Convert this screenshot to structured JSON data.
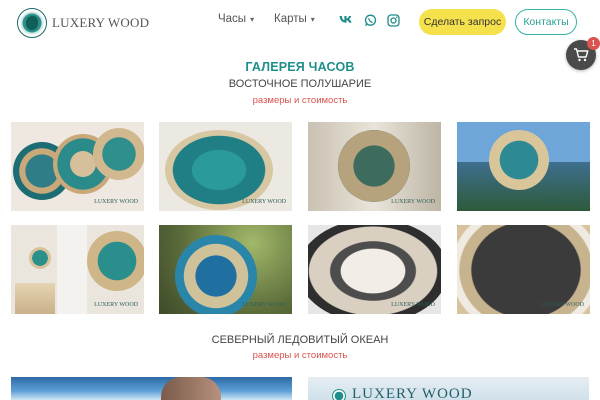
{
  "header": {
    "logo_text": "LUXERY WOOD",
    "nav": [
      {
        "label": "Часы"
      },
      {
        "label": "Карты"
      }
    ],
    "social": [
      {
        "name": "vk-icon",
        "glyph": "vk"
      },
      {
        "name": "whatsapp-icon",
        "glyph": "✆"
      },
      {
        "name": "instagram-icon",
        "glyph": "◎"
      }
    ],
    "request_button": "Сделать запрос",
    "contacts_button": "Контакты",
    "cart_count": "1"
  },
  "gallery": {
    "title": "ГАЛЕРЕЯ ЧАСОВ",
    "subtitle": "ВОСТОЧНОЕ ПОЛУШАРИЕ",
    "link": "размеры и стоимость",
    "watermark": "LUXERY WOOD"
  },
  "section2": {
    "subtitle": "СЕВЕРНЫЙ ЛЕДОВИТЫЙ ОКЕАН",
    "link": "размеры и стоимость"
  },
  "colors": {
    "accent": "#1f8f8c",
    "button_yellow": "#f4e14c",
    "link_red": "#d9534f",
    "cart_bg": "#4a4a4a"
  }
}
